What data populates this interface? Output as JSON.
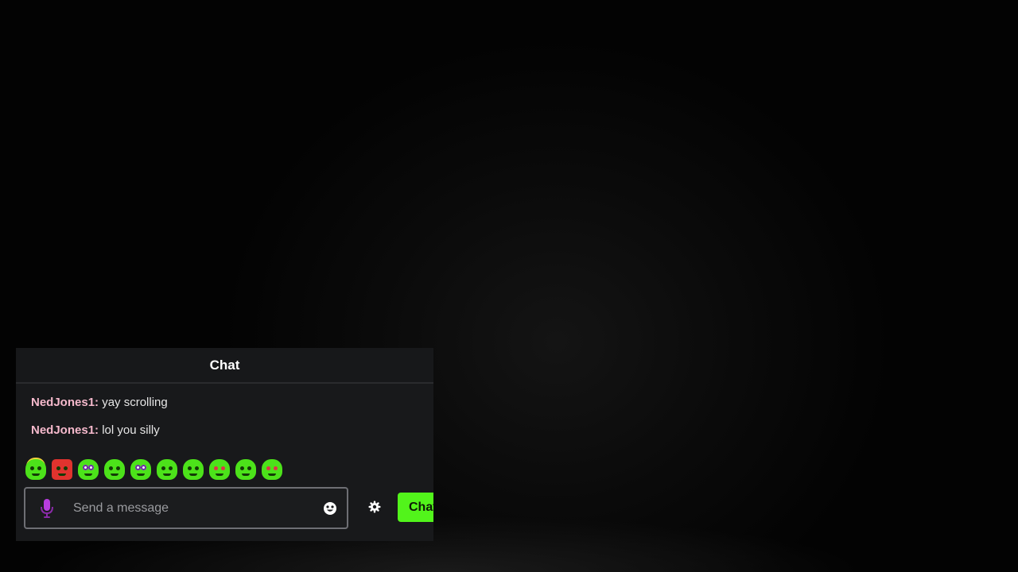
{
  "chat": {
    "title": "Chat",
    "messages": [
      {
        "user": "NedJones1:",
        "text": "yay scrolling"
      },
      {
        "user": "NedJones1:",
        "text": "lol you silly"
      }
    ],
    "emotes": [
      "angel-emote",
      "angry-emote",
      "googly-eyes-emote",
      "smirk-emote",
      "headphones-emote",
      "smile-emote",
      "happy-emote",
      "wow-emote",
      "sick-emote",
      "heart-eyes-emote"
    ],
    "input": {
      "placeholder": "Send a message",
      "value": ""
    },
    "send_label": "Chat",
    "icons": {
      "mic": "microphone-icon",
      "emoji": "smiley-icon",
      "settings": "gear-icon"
    },
    "colors": {
      "accent": "#52f41b",
      "username": "#f5b9cc",
      "mic": "#b93de0",
      "panel": "#18191b"
    }
  }
}
